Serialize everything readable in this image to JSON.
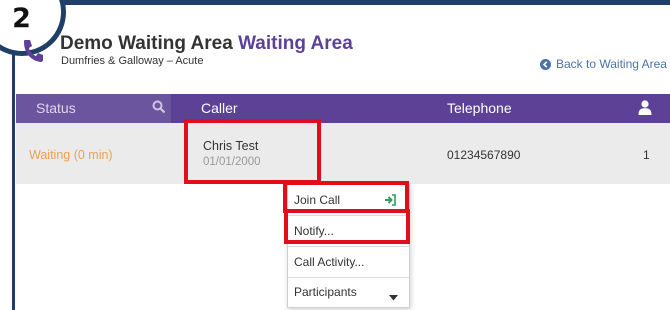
{
  "step": {
    "number": "2"
  },
  "header": {
    "title_main": "Demo Waiting Area",
    "title_accent": "Waiting Area",
    "subtitle": "Dumfries & Galloway – Acute",
    "back_link": "Back to Waiting Area"
  },
  "table": {
    "headers": {
      "status": "Status",
      "caller": "Caller",
      "telephone": "Telephone"
    },
    "rows": [
      {
        "status": "Waiting (0 min)",
        "caller_name": "Chris Test",
        "caller_dob": "01/01/2000",
        "telephone": "01234567890",
        "participants": "1"
      }
    ]
  },
  "menu": {
    "items": [
      {
        "label": "Join Call"
      },
      {
        "label": "Notify..."
      },
      {
        "label": "Call Activity..."
      },
      {
        "label": "Participants"
      }
    ]
  },
  "colors": {
    "brand_purple": "#5c4197",
    "status_waiting": "#f0a04b",
    "highlight_red": "#e10c1c",
    "join_green": "#2aa05a",
    "link_blue": "#4a74a8"
  },
  "icons": {
    "back": "chevron-left-circle-icon",
    "search": "search-icon",
    "participants": "user-icon",
    "join": "enter-icon",
    "dropdown": "caret-down-icon",
    "app_logo": "phone-handset-icon"
  }
}
